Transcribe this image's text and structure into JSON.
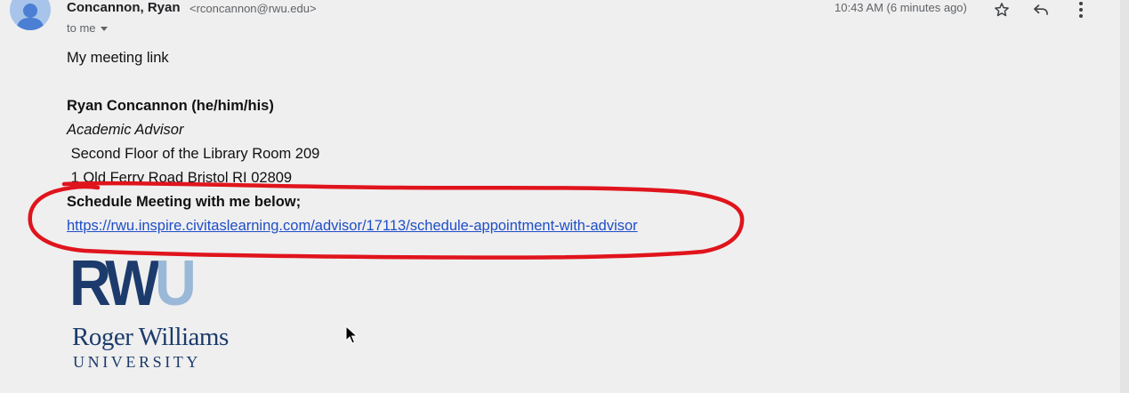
{
  "sender": {
    "name": "Concannon, Ryan",
    "email": "<rconcannon@rwu.edu>",
    "recipient": "to me",
    "timestamp": "10:43 AM (6 minutes ago)"
  },
  "actions": {
    "star_icon": "star-icon",
    "reply_icon": "reply-icon",
    "more_icon": "more-vert-icon"
  },
  "message": {
    "intro": "My meeting link",
    "signature": {
      "name": "Ryan Concannon (he/him/his)",
      "title": "Academic Advisor",
      "address_line1": " Second Floor of the Library Room 209",
      "address_line2": " 1 Old Ferry Road Bristol RI 02809",
      "schedule_heading": "Schedule Meeting with me below;",
      "schedule_link": "https://rwu.inspire.civitaslearning.com/advisor/17113/schedule-appointment-with-advisor"
    }
  },
  "logo": {
    "letters_main": "RW",
    "letters_accent": "U",
    "name": "Roger Williams",
    "subtitle": "UNIVERSITY"
  },
  "colors": {
    "background": "#efefef",
    "link": "#1f4ec7",
    "annotation": "#e0141c",
    "logo_navy": "#1c3b6c",
    "logo_light": "#9ab8d8",
    "avatar": "#a9c4ea"
  }
}
